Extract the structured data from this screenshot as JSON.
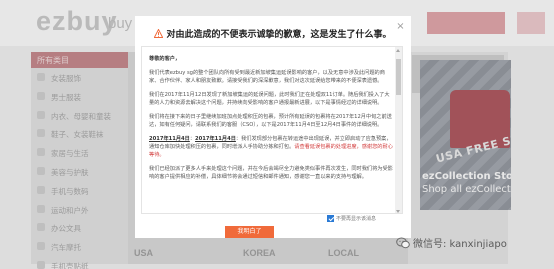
{
  "header": {
    "logo": "ezbuy",
    "search_hint": "buy"
  },
  "category_menu": {
    "heading": "所有类目",
    "items": [
      "女装服饰",
      "男士服装",
      "内衣、母婴和童装",
      "鞋子、女装鞋袜",
      "家居与生活",
      "美容与护肤",
      "手机与数码",
      "运动和户外",
      "办公文具",
      "汽车摩托",
      "手机壳贴纸"
    ]
  },
  "promo": {
    "badge": "USA FREE SHIPPING",
    "title": "ezCollection Store",
    "subtitle": "Shop all ezCollection"
  },
  "region_tabs": [
    "USA",
    "KOREA",
    "LOCAL"
  ],
  "watermark": {
    "text": "微信号: kanxinjiapo"
  },
  "modal": {
    "title": "对由此造成的不便表示诚挚的歉意，这是发生了什么事。",
    "close_symbol": "×",
    "greeting": "尊敬的客户，",
    "paragraphs": [
      "我们代表ezbuy sg的整个团队向所有受到最近新加坡集运延误影响的客户，以及无意中涉及此问题的商家、合作伙伴、家人和朋友致歉。请接受我们的深深歉意，我们对这次延误给您带来的不便深表遗憾。",
      "我们在2017年11月12日发现了新加坡集运的延误问题，此时我们正在处理双11订单。随后我们投入了大量的人力和资源去解决这个问题，并持续向受影响的客户通报最新进展，以下是事情经过的详细说明。",
      "我们将在接下来的日子里继续加班加点处理积压的包裹，预计所有延误的包裹将在2017年12月中旬之前送达，如有任何疑问，请联系我们的客服（CSO），以下是2017年11月4日至12月4日事件的详细说明。"
    ],
    "timeline_date_1": "2017年11月4日",
    "timeline_date_2": "2017年11月4日",
    "timeline_text": "：我们发现部分包裹在转运途中出现延误，并立即启动了应急预案，通知仓库加快处理积压的包裹，同时增派人手协助分拣和打包。",
    "timeline_link": "请查看延误包裹的处理进度，感谢您的耐心等待。",
    "paragraph_last": "我们已经加派了更多人手来处理这个问题，并在今后会竭尽全力避免类似事件再次发生，同时我们将为受影响的客户提供相应的补偿，具体细节将会通过短信和邮件通知，感谢您一直以来的支持与理解。",
    "dont_show_label": "不要再显示该消息",
    "ok_button": "我明白了"
  },
  "colors": {
    "accent": "#f06a3a",
    "category_head": "#c47f84",
    "checkbox": "#2a7ad5"
  }
}
